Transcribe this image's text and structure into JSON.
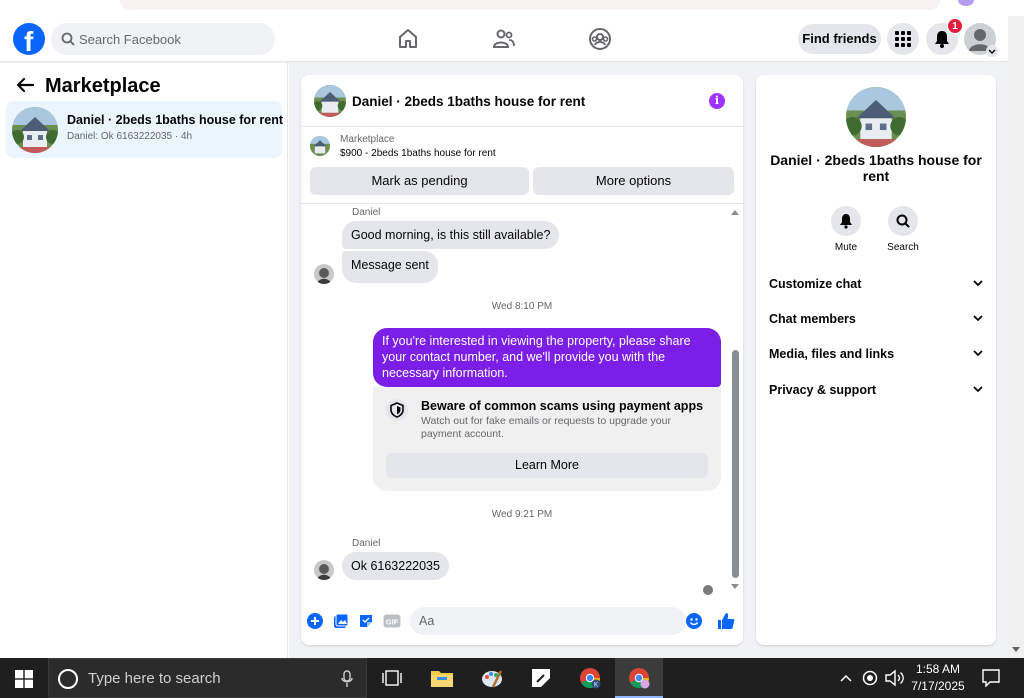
{
  "header": {
    "logo_letter": "f",
    "search_placeholder": "Search Facebook",
    "find_friends_label": "Find friends",
    "notification_count": "1"
  },
  "sidebar": {
    "title": "Marketplace",
    "conversations": [
      {
        "name": "Daniel · 2beds 1baths house for rent",
        "preview": "Daniel: Ok 6163222035 · 4h"
      }
    ]
  },
  "chat": {
    "title": "Daniel · 2beds 1baths house for rent",
    "marketplace_label": "Marketplace",
    "listing": "$900 - 2beds 1baths house for rent",
    "mark_pending_label": "Mark as pending",
    "more_options_label": "More options",
    "messages": {
      "sender_1": "Daniel",
      "msg_1": "Good morning, is this still available?",
      "msg_2": "Message sent",
      "time_1": "Wed 8:10 PM",
      "outgoing": "If you're interested in viewing the property, please share your contact number, and we'll provide you with the necessary information.",
      "scam_title": "Beware of common scams using payment apps",
      "scam_desc": "Watch out for fake emails or requests to upgrade your payment account.",
      "learn_more": "Learn More",
      "time_2": "Wed 9:21 PM",
      "sender_2": "Daniel",
      "msg_3": "Ok 6163222035"
    },
    "composer_placeholder": "Aa"
  },
  "info_panel": {
    "title": "Daniel · 2beds 1baths house for rent",
    "mute_label": "Mute",
    "search_label": "Search",
    "rows": [
      "Customize chat",
      "Chat members",
      "Media, files and links",
      "Privacy & support"
    ]
  },
  "taskbar": {
    "search_placeholder": "Type here to search",
    "time": "1:58 AM",
    "date": "7/17/2025"
  },
  "colors": {
    "facebook_blue": "#0866ff",
    "messenger_purple": "#7b1fe8",
    "selected_bg": "#ebf5ff"
  }
}
